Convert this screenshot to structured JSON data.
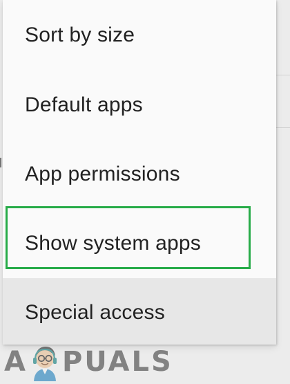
{
  "menu": {
    "items": [
      {
        "label": "Sort by size"
      },
      {
        "label": "Default apps"
      },
      {
        "label": "App permissions"
      },
      {
        "label": "Show system apps",
        "highlighted": true
      },
      {
        "label": "Special access",
        "pressed": true
      }
    ],
    "highlight_color": "#27ab48"
  },
  "watermark": {
    "prefix": "A",
    "suffix": "PUALS",
    "icon": "appuals-mascot-icon"
  },
  "colors": {
    "menu_background": "#fafafa",
    "pressed_background": "#e7e7e7",
    "text": "#222222"
  }
}
